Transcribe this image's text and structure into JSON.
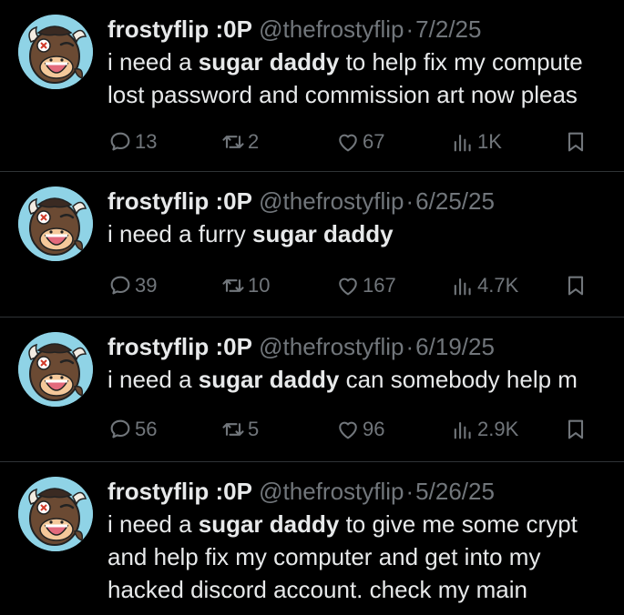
{
  "tweets": [
    {
      "display_name": "frostyflip :0P",
      "handle": "@thefrostyflip",
      "date": "7/2/25",
      "lines": [
        [
          {
            "t": "i need a ",
            "b": false
          },
          {
            "t": "sugar daddy",
            "b": true
          },
          {
            "t": " to help fix my compute",
            "b": false
          }
        ],
        [
          {
            "t": "lost password and commission art now pleas",
            "b": false
          }
        ]
      ],
      "replies": "13",
      "retweets": "2",
      "likes": "67",
      "views": "1K"
    },
    {
      "display_name": "frostyflip :0P",
      "handle": "@thefrostyflip",
      "date": "6/25/25",
      "lines": [
        [
          {
            "t": "i need a furry ",
            "b": false
          },
          {
            "t": "sugar daddy",
            "b": true
          }
        ]
      ],
      "replies": "39",
      "retweets": "10",
      "likes": "167",
      "views": "4.7K"
    },
    {
      "display_name": "frostyflip :0P",
      "handle": "@thefrostyflip",
      "date": "6/19/25",
      "lines": [
        [
          {
            "t": "i need a ",
            "b": false
          },
          {
            "t": "sugar daddy",
            "b": true
          },
          {
            "t": " can somebody help m",
            "b": false
          }
        ]
      ],
      "replies": "56",
      "retweets": "5",
      "likes": "96",
      "views": "2.9K"
    },
    {
      "display_name": "frostyflip :0P",
      "handle": "@thefrostyflip",
      "date": "5/26/25",
      "lines": [
        [
          {
            "t": "i need a ",
            "b": false
          },
          {
            "t": "sugar daddy",
            "b": true
          },
          {
            "t": " to give me some crypt",
            "b": false
          }
        ],
        [
          {
            "t": "and help fix my computer and get into my",
            "b": false
          }
        ],
        [
          {
            "t": "hacked discord account. check my main",
            "b": false
          }
        ]
      ]
    }
  ],
  "icons": {
    "reply": "speech-bubble-icon",
    "retweet": "retweet-arrows-icon",
    "like": "heart-icon",
    "views": "bar-chart-icon",
    "bookmark": "bookmark-icon"
  },
  "colors": {
    "background": "#000000",
    "text_primary": "#e7e9ea",
    "text_secondary": "#71767b",
    "divider": "#2f3336",
    "avatar_bg": "#8fd3e6"
  },
  "separator": "·"
}
